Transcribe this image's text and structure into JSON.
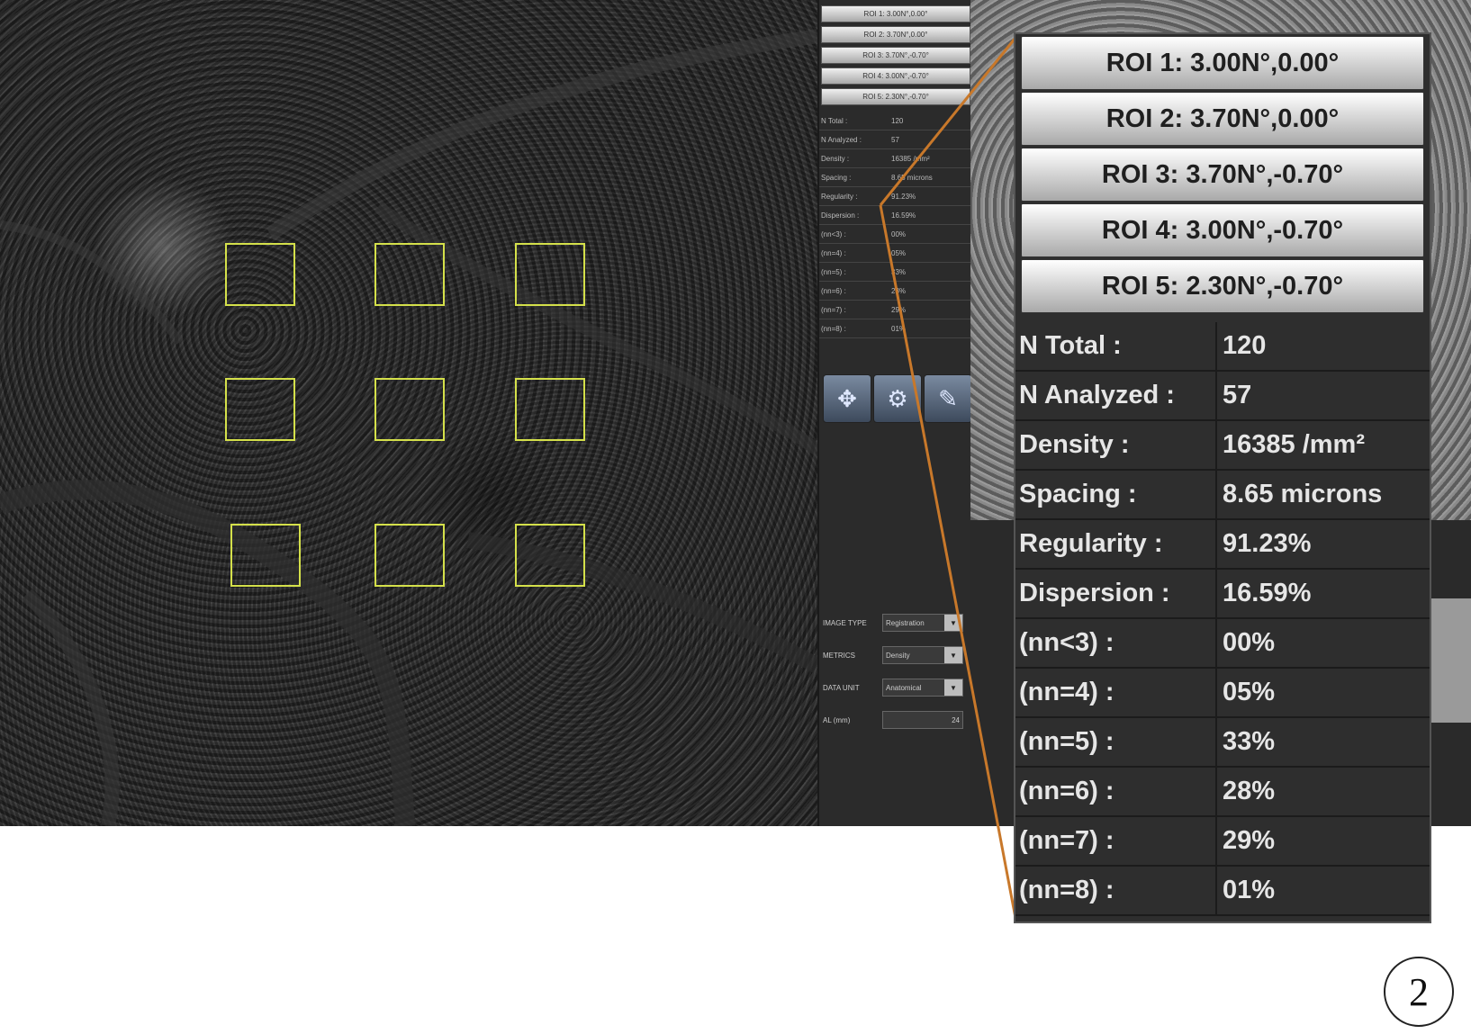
{
  "roi_buttons": [
    {
      "label": "ROI 1: 3.00N°,0.00°"
    },
    {
      "label": "ROI 2: 3.70N°,0.00°"
    },
    {
      "label": "ROI 3: 3.70N°,-0.70°"
    },
    {
      "label": "ROI 4: 3.00N°,-0.70°"
    },
    {
      "label": "ROI 5: 2.30N°,-0.70°"
    }
  ],
  "stats": [
    {
      "label": "N Total :",
      "value": "120"
    },
    {
      "label": "N Analyzed :",
      "value": "57"
    },
    {
      "label": "Density :",
      "value": "16385 /mm²"
    },
    {
      "label": "Spacing :",
      "value": "8.65 microns"
    },
    {
      "label": "Regularity :",
      "value": "91.23%"
    },
    {
      "label": "Dispersion :",
      "value": "16.59%"
    },
    {
      "label": "(nn<3) :",
      "value": "00%"
    },
    {
      "label": "(nn=4) :",
      "value": "05%"
    },
    {
      "label": "(nn=5) :",
      "value": "33%"
    },
    {
      "label": "(nn=6) :",
      "value": "28%"
    },
    {
      "label": "(nn=7) :",
      "value": "29%"
    },
    {
      "label": "(nn=8) :",
      "value": "01%"
    }
  ],
  "small_panel": {
    "stat_labels": [
      "N Total :",
      "N Analyzed :",
      "Density :",
      "Spacing :",
      "Regularity :",
      "Dispersion :",
      "(nn<3) :",
      "(nn=4) :",
      "(nn=5) :",
      "(nn=6) :",
      "(nn=7) :",
      "(nn=8) :"
    ],
    "stat_values": [
      "120",
      "57",
      "16385 /mm²",
      "8.65 microns",
      "91.23%",
      "16.59%",
      "00%",
      "05%",
      "33%",
      "28%",
      "29%",
      "01%"
    ],
    "controls": [
      {
        "label": "IMAGE TYPE",
        "value": "Registration"
      },
      {
        "label": "METRICS",
        "value": "Density"
      },
      {
        "label": "DATA UNIT",
        "value": "Anatomical"
      },
      {
        "label": "AL (mm)",
        "value": "24"
      }
    ],
    "tools": [
      "move-icon",
      "settings-icon",
      "brush-icon"
    ]
  },
  "figure_label": "2",
  "colors": {
    "roi_box": "#d4e04a",
    "leader_line": "#c8782a",
    "panel_bg": "#2e2e2e"
  }
}
